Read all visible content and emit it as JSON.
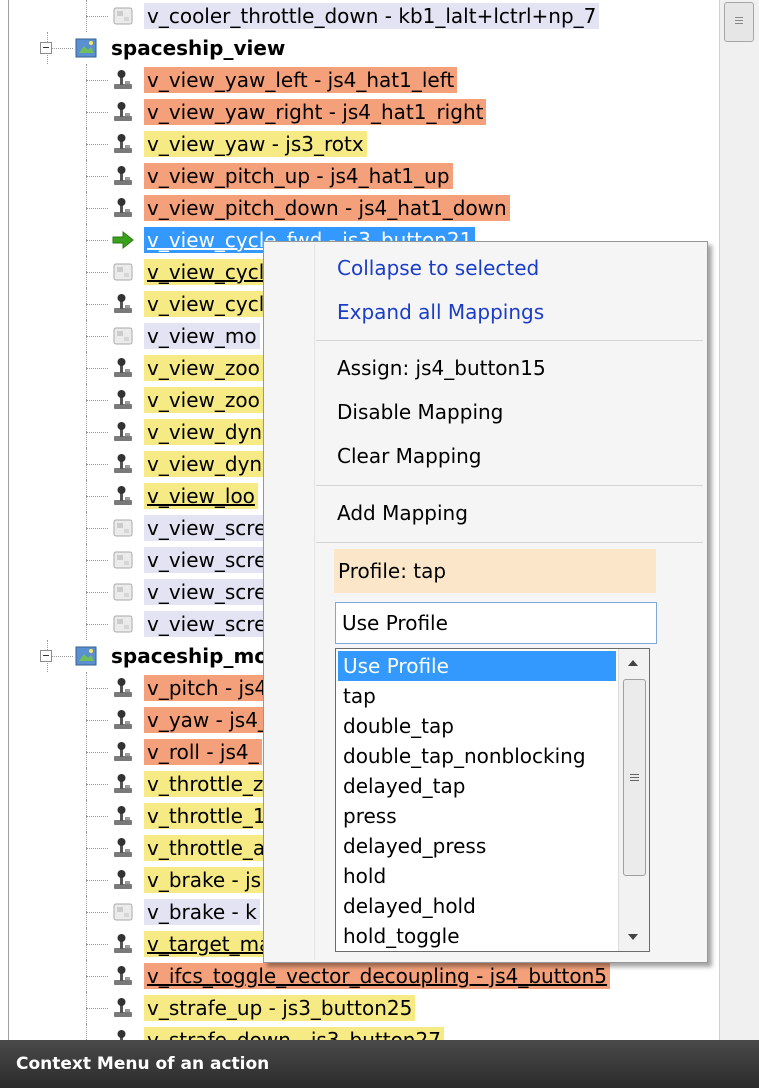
{
  "tree": {
    "rows": [
      {
        "label": "v_cooler_throttle_down - kb1_lalt+lctrl+np_7",
        "kind": "keyboard",
        "bg": "l",
        "underline": false
      },
      {
        "label": "spaceship_view",
        "kind": "category"
      },
      {
        "label": "v_view_yaw_left - js4_hat1_left",
        "kind": "joystick",
        "bg": "o",
        "underline": false
      },
      {
        "label": "v_view_yaw_right - js4_hat1_right",
        "kind": "joystick",
        "bg": "o",
        "underline": false
      },
      {
        "label": "v_view_yaw - js3_rotx",
        "kind": "joystick",
        "bg": "y",
        "underline": false
      },
      {
        "label": "v_view_pitch_up - js4_hat1_up",
        "kind": "joystick",
        "bg": "o",
        "underline": false
      },
      {
        "label": "v_view_pitch_down - js4_hat1_down",
        "kind": "joystick",
        "bg": "o",
        "underline": false
      },
      {
        "label": "v_view_cycle_fwd - js3_button21",
        "kind": "arrow",
        "bg": "s",
        "underline": true
      },
      {
        "label": "v_view_cycle",
        "kind": "keyboard",
        "bg": "y",
        "underline": true
      },
      {
        "label": "v_view_cycl",
        "kind": "joystick",
        "bg": "y",
        "underline": false
      },
      {
        "label": "v_view_mo",
        "kind": "keyboard",
        "bg": "l",
        "underline": false
      },
      {
        "label": "v_view_zoo",
        "kind": "joystick",
        "bg": "y",
        "underline": false
      },
      {
        "label": "v_view_zoo",
        "kind": "joystick",
        "bg": "y",
        "underline": false
      },
      {
        "label": "v_view_dyn",
        "kind": "joystick",
        "bg": "y",
        "underline": false
      },
      {
        "label": "v_view_dyn",
        "kind": "joystick",
        "bg": "y",
        "underline": false
      },
      {
        "label": "v_view_loo",
        "kind": "joystick",
        "bg": "y",
        "underline": true
      },
      {
        "label": "v_view_scre",
        "kind": "keyboard",
        "bg": "l",
        "underline": false
      },
      {
        "label": "v_view_scre",
        "kind": "keyboard",
        "bg": "l",
        "underline": false
      },
      {
        "label": "v_view_scre",
        "kind": "keyboard",
        "bg": "l",
        "underline": false
      },
      {
        "label": "v_view_scre",
        "kind": "keyboard",
        "bg": "l",
        "underline": false
      },
      {
        "label": "spaceship_mov",
        "kind": "category"
      },
      {
        "label": "v_pitch - js4",
        "kind": "joystick",
        "bg": "o",
        "underline": false
      },
      {
        "label": "v_yaw - js4_",
        "kind": "joystick",
        "bg": "o",
        "underline": false
      },
      {
        "label": "v_roll - js4_",
        "kind": "joystick",
        "bg": "o",
        "underline": false
      },
      {
        "label": "v_throttle_z",
        "kind": "joystick",
        "bg": "y",
        "underline": false
      },
      {
        "label": "v_throttle_1",
        "kind": "joystick",
        "bg": "y",
        "underline": false
      },
      {
        "label": "v_throttle_a",
        "kind": "joystick",
        "bg": "y",
        "underline": false
      },
      {
        "label": "v_brake - js",
        "kind": "joystick",
        "bg": "y",
        "underline": false
      },
      {
        "label": "v_brake - k",
        "kind": "keyboard",
        "bg": "l",
        "underline": false
      },
      {
        "label": "v_target_ma",
        "kind": "joystick",
        "bg": "y",
        "underline": true
      },
      {
        "label": "v_ifcs_toggle_vector_decoupling - js4_button5",
        "kind": "joystick",
        "bg": "o",
        "underline": true
      },
      {
        "label": "v_strafe_up - js3_button25",
        "kind": "joystick",
        "bg": "y",
        "underline": false
      },
      {
        "label": "v_strafe_down - js3_button27",
        "kind": "joystick",
        "bg": "y",
        "underline": false
      }
    ]
  },
  "context_menu": {
    "collapse": "Collapse to selected",
    "expand": "Expand all Mappings",
    "assign": "Assign: js4_button15",
    "disable": "Disable Mapping",
    "clear": "Clear Mapping",
    "add": "Add Mapping",
    "profile_label": "Profile: tap",
    "profile_input": "Use Profile",
    "profile_options": [
      "Use Profile",
      "tap",
      "double_tap",
      "double_tap_nonblocking",
      "delayed_tap",
      "press",
      "delayed_press",
      "hold",
      "delayed_hold",
      "hold_toggle"
    ],
    "selected_option": 0
  },
  "caption": "Context Menu of an action",
  "colors": {
    "orange": "#f4a07a",
    "yellow": "#f5ea84",
    "lavender": "#e3e3f4",
    "selection": "#3399ff",
    "link": "#1a3cc8",
    "profile_bg": "#fce6c9"
  }
}
